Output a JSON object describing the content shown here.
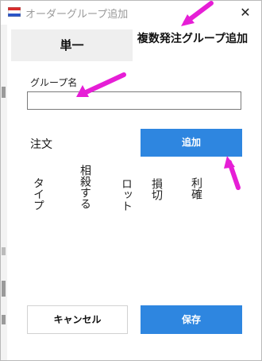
{
  "window": {
    "title": "オーダーグループ追加",
    "close_glyph": "✕"
  },
  "tabs": [
    {
      "label": "単一"
    },
    {
      "label": "複数発注グループ追加"
    }
  ],
  "form": {
    "group_name_label": "グループ名",
    "group_name_value": "",
    "orders_label": "注文",
    "add_button_label": "追加"
  },
  "columns": [
    "タイプ",
    "相殺する",
    "ロット",
    "損切",
    "利確"
  ],
  "footer": {
    "cancel_label": "キャンセル",
    "save_label": "保存"
  },
  "colors": {
    "accent": "#2e86e0",
    "annotation": "#e61ed6"
  },
  "icons": [
    "app-flag-icon",
    "close-icon"
  ]
}
